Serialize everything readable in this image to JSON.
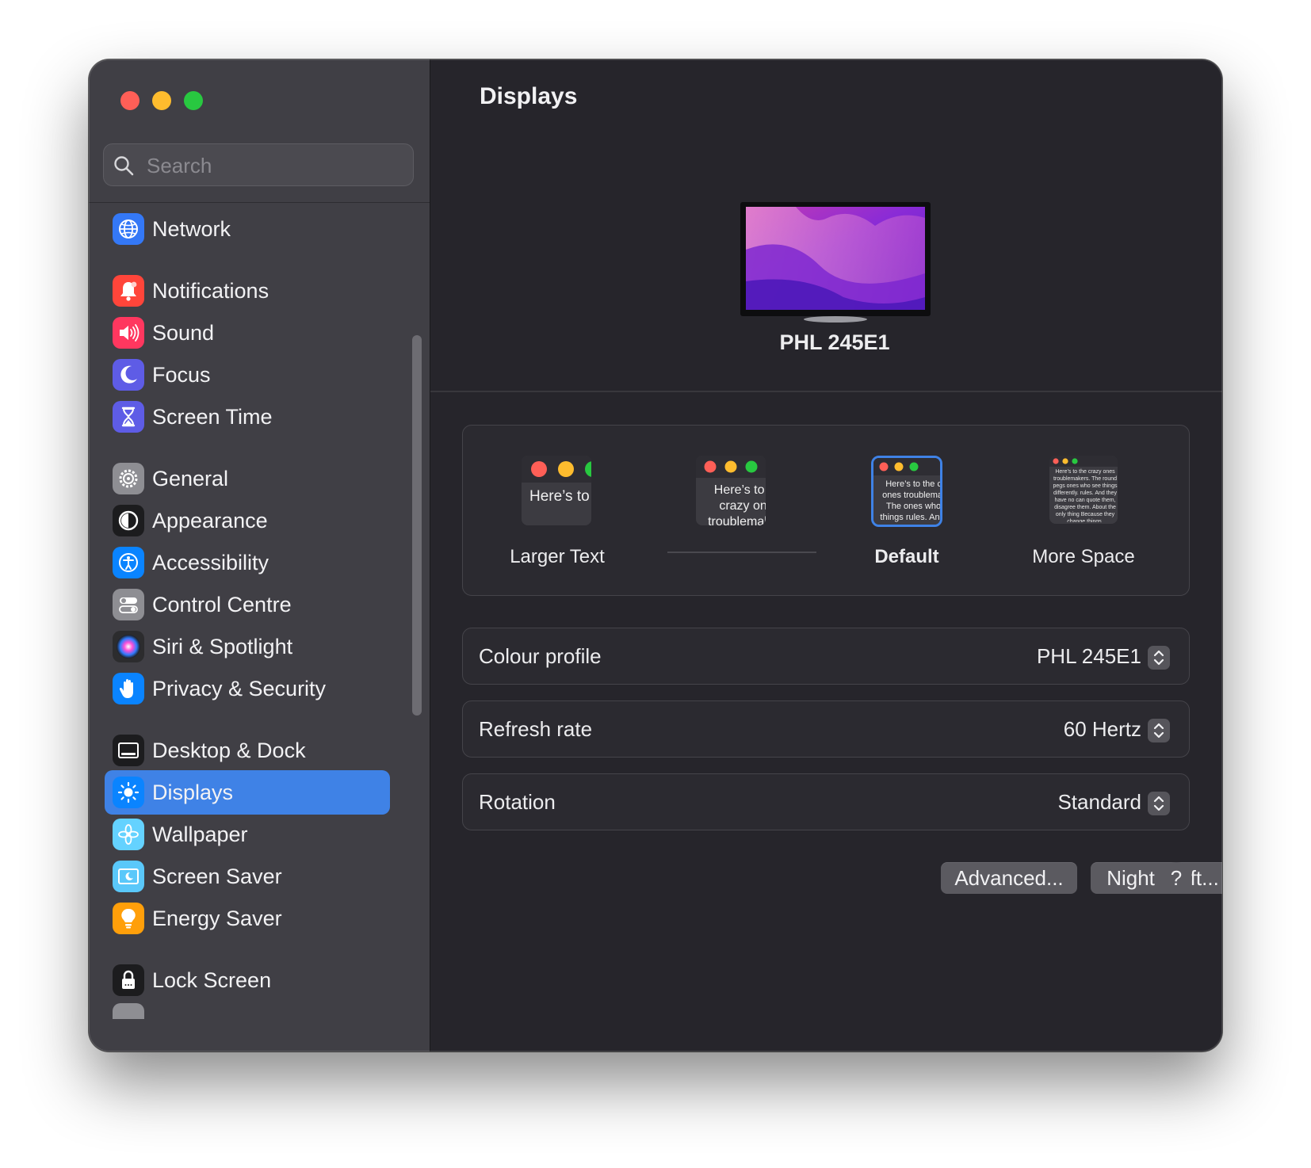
{
  "window": {
    "traffic_lights": [
      "close",
      "minimize",
      "zoom"
    ]
  },
  "search": {
    "placeholder": "Search",
    "value": ""
  },
  "sidebar": {
    "selected": "Displays",
    "items": [
      {
        "label": "Network",
        "icon": "globe-icon",
        "color": "#3478f6"
      },
      {
        "label": "Notifications",
        "icon": "bell-icon",
        "color": "#ff453a"
      },
      {
        "label": "Sound",
        "icon": "speaker-icon",
        "color": "#ff375f"
      },
      {
        "label": "Focus",
        "icon": "moon-icon",
        "color": "#5e5ce6"
      },
      {
        "label": "Screen Time",
        "icon": "hourglass-icon",
        "color": "#5e5ce6"
      },
      {
        "label": "General",
        "icon": "gear-icon",
        "color": "#8e8e93"
      },
      {
        "label": "Appearance",
        "icon": "appearance-icon",
        "color": "#1c1c1e"
      },
      {
        "label": "Accessibility",
        "icon": "accessibility-icon",
        "color": "#0a84ff"
      },
      {
        "label": "Control Centre",
        "icon": "toggles-icon",
        "color": "#8e8e93"
      },
      {
        "label": "Siri & Spotlight",
        "icon": "siri-icon",
        "color": "#2c2c2e"
      },
      {
        "label": "Privacy & Security",
        "icon": "hand-icon",
        "color": "#0a84ff"
      },
      {
        "label": "Desktop & Dock",
        "icon": "dock-icon",
        "color": "#1c1c1e"
      },
      {
        "label": "Displays",
        "icon": "sun-icon",
        "color": "#0a84ff"
      },
      {
        "label": "Wallpaper",
        "icon": "flower-icon",
        "color": "#64d2ff"
      },
      {
        "label": "Screen Saver",
        "icon": "screensaver-icon",
        "color": "#5ac8fa"
      },
      {
        "label": "Energy Saver",
        "icon": "bulb-icon",
        "color": "#ff9f0a"
      },
      {
        "label": "Lock Screen",
        "icon": "lock-icon",
        "color": "#1c1c1e"
      }
    ]
  },
  "main": {
    "title": "Displays",
    "display_name": "PHL 245E1",
    "resolution": {
      "options": [
        {
          "label": "Larger Text",
          "preview_text": "Here’s to the crazy ones troublemakers.",
          "selected": false
        },
        {
          "label": "",
          "preview_text": "Here’s to the crazy ones troublemakers. The ones who",
          "selected": false
        },
        {
          "label": "Default",
          "preview_text": "Here’s to the crazy ones troublemakers. The ones who see things rules. And they",
          "selected": true
        },
        {
          "label": "More Space",
          "preview_text": "Here’s to the crazy ones troublemakers. The round pegs ones who see things differently. rules. And they have no can quote them, disagree them. About the only thing Because they change things.",
          "selected": false
        }
      ]
    },
    "settings": [
      {
        "label": "Colour profile",
        "value": "PHL 245E1"
      },
      {
        "label": "Refresh rate",
        "value": "60 Hertz"
      },
      {
        "label": "Rotation",
        "value": "Standard"
      }
    ],
    "buttons": {
      "advanced": "Advanced...",
      "night_shift": "Night Shift...",
      "help": "?"
    }
  }
}
